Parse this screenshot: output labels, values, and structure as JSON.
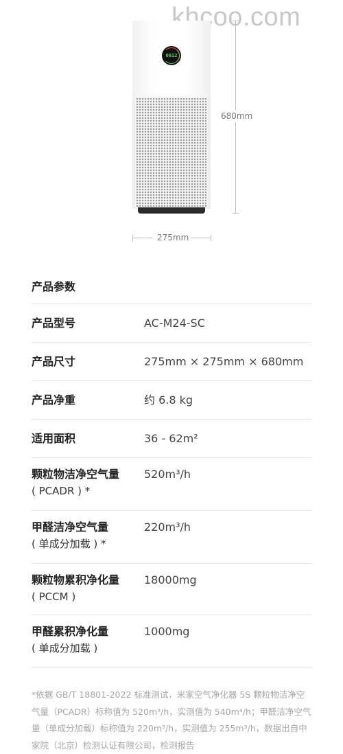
{
  "watermark": "khcoo.com",
  "product_image": {
    "display_value": "0012",
    "icon": "air-purifier-icon"
  },
  "dimensions": {
    "height_label": "680mm",
    "width_label": "275mm"
  },
  "spec_section": {
    "title": "产品参数",
    "rows": [
      {
        "label": "产品型号",
        "sub": "",
        "value": "AC-M24-SC"
      },
      {
        "label": "产品尺寸",
        "sub": "",
        "value": "275mm × 275mm × 680mm"
      },
      {
        "label": "产品净重",
        "sub": "",
        "value": "约 6.8 kg"
      },
      {
        "label": "适用面积",
        "sub": "",
        "value": "36 - 62m²"
      },
      {
        "label": "颗粒物洁净空气量",
        "sub": "( PCADR ) *",
        "value": "520m³/h"
      },
      {
        "label": "甲醛洁净空气量",
        "sub": "( 单成分加载 ) *",
        "value": "220m³/h"
      },
      {
        "label": "颗粒物累积净化量",
        "sub": "( PCCM )",
        "value": "18000mg"
      },
      {
        "label": "甲醛累积净化量",
        "sub": "( 单成分加载 )",
        "value": "1000mg"
      }
    ]
  },
  "footnote": "*依据 GB/T 18801-2022 标准测试，米家空气净化器 5S 颗粒物洁净空气量（PCADR）标称值为 520m³/h，实测值为 540m³/h；甲醛洁净空气量（单成分加载）标称值为 220m³/h，实测值为 255m³/h，数据出自中家院（北京）检测认证有限公司，检测报告"
}
